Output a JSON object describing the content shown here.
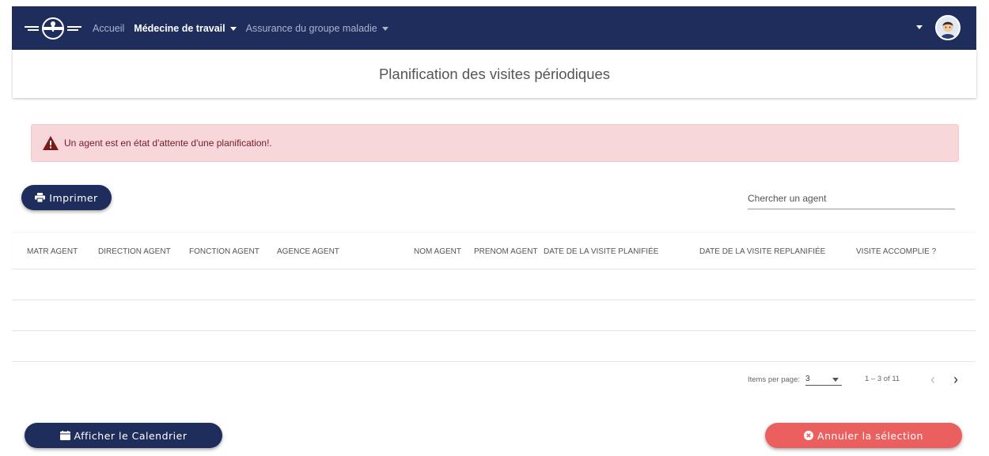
{
  "navbar": {
    "links": [
      {
        "label": "Accueil"
      },
      {
        "label": "Médecine de travail"
      },
      {
        "label": "Assurance du groupe maladie"
      }
    ]
  },
  "page": {
    "title": "Planification des visites périodiques"
  },
  "alert": {
    "message": "Un agent est en état d'attente d'une planification!."
  },
  "toolbar": {
    "print_label": "Imprimer",
    "search_placeholder": "Chercher un agent"
  },
  "table": {
    "columns": [
      "MATR AGENT",
      "DIRECTION AGENT",
      "FONCTION AGENT",
      "AGENCE AGENT",
      "NOM AGENT",
      "PRENOM AGENT",
      "DATE DE LA VISITE PLANIFIÉE",
      "DATE DE LA VISITE REPLANIFIÉE",
      "VISITE ACCOMPLIE ?"
    ],
    "rows": [
      [],
      [],
      []
    ]
  },
  "paginator": {
    "items_per_page_label": "Items per page:",
    "page_size": "3",
    "range_label": "1 – 3 of 11"
  },
  "footer": {
    "calendar_label": "Afficher le Calendrier",
    "cancel_label": "Annuler la sélection"
  },
  "colors": {
    "navbar": "#1f2d5c",
    "alert_bg": "#f8d7da",
    "alert_text": "#721c24",
    "cancel_button": "#ec5f5f"
  }
}
